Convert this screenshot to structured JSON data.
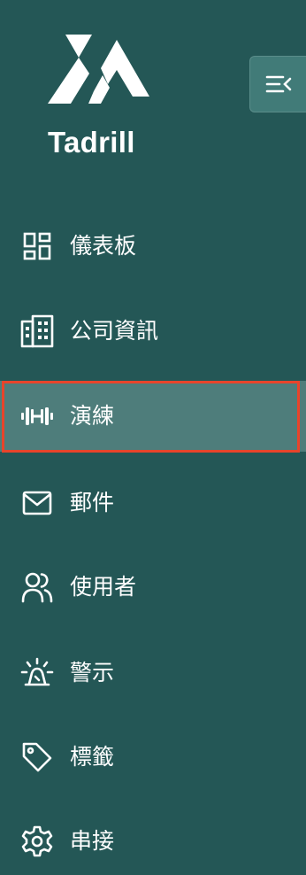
{
  "brand": {
    "name": "Tadrill",
    "logo_icon": "tadrill-logo-mark"
  },
  "collapse_button": {
    "icon": "menu-collapse-icon"
  },
  "nav": {
    "items": [
      {
        "label": "儀表板",
        "icon": "dashboard-icon",
        "active": false
      },
      {
        "label": "公司資訊",
        "icon": "building-icon",
        "active": false
      },
      {
        "label": "演練",
        "icon": "dumbbell-icon",
        "active": true
      },
      {
        "label": "郵件",
        "icon": "mail-icon",
        "active": false
      },
      {
        "label": "使用者",
        "icon": "users-icon",
        "active": false
      },
      {
        "label": "警示",
        "icon": "alarm-icon",
        "active": false
      },
      {
        "label": "標籤",
        "icon": "tag-icon",
        "active": false
      },
      {
        "label": "串接",
        "icon": "gear-icon",
        "active": false
      }
    ]
  },
  "colors": {
    "sidebar_bg": "#245756",
    "active_bg": "#4e7d7b",
    "highlight_outline": "#e8442b",
    "text": "#ffffff"
  }
}
